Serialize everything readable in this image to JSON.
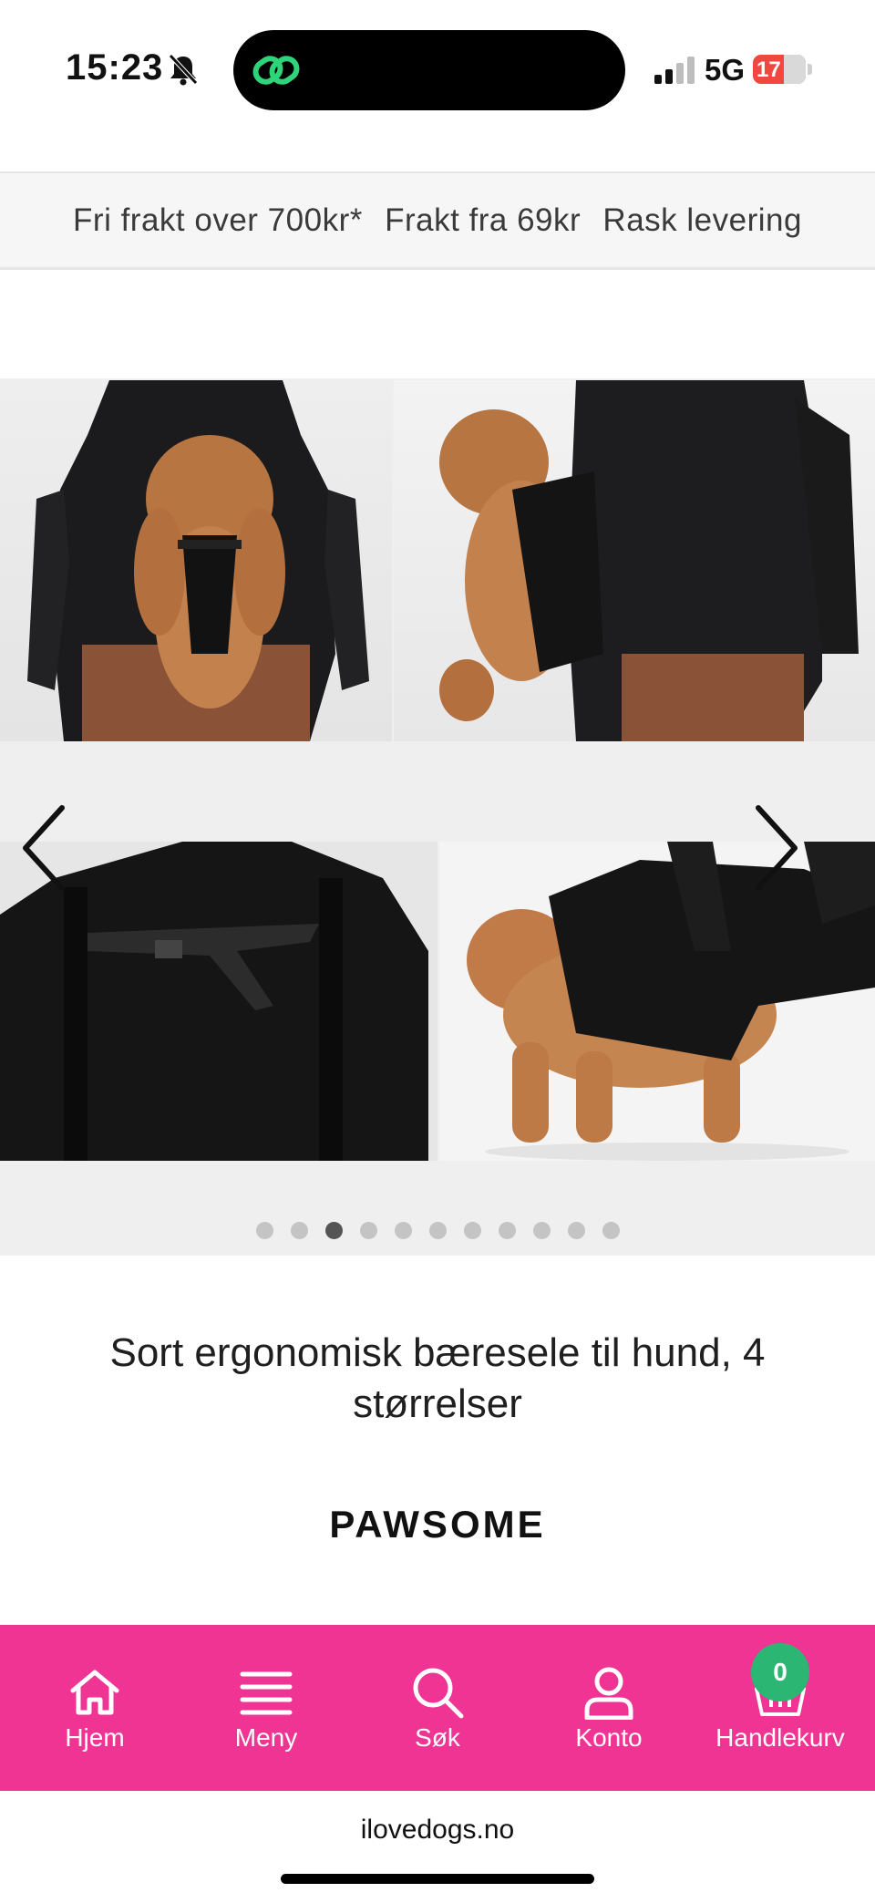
{
  "status_bar": {
    "time": "15:23",
    "network": "5G",
    "battery_level": "17",
    "battery_color": "#f0483e"
  },
  "promo": {
    "items": [
      "Fri frakt over 700kr*",
      "Frakt fra 69kr",
      "Rask levering"
    ]
  },
  "gallery": {
    "slide_count": 11,
    "active_index": 2,
    "prev_icon": "chevron-left-icon",
    "next_icon": "chevron-right-icon"
  },
  "product": {
    "title": "Sort ergonomisk bæresele til hund, 4 størrelser",
    "brand": "PAWSOME"
  },
  "bottom_nav": {
    "background": "#ef3494",
    "items": [
      {
        "label": "Hjem",
        "icon": "home-icon"
      },
      {
        "label": "Meny",
        "icon": "menu-icon"
      },
      {
        "label": "Søk",
        "icon": "search-icon"
      },
      {
        "label": "Konto",
        "icon": "user-icon"
      },
      {
        "label": "Handlekurv",
        "icon": "basket-icon"
      }
    ],
    "cart_count": "0",
    "badge_color": "#2bb673"
  },
  "browser": {
    "url": "ilovedogs.no"
  }
}
